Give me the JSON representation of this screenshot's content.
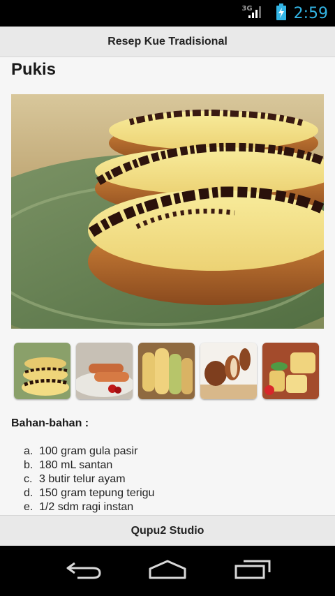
{
  "status_bar": {
    "network_type": "3G",
    "time": "2:59",
    "icons": [
      "signal-icon",
      "battery-charging-icon"
    ],
    "accent_color": "#33b5e5"
  },
  "app_bar": {
    "title": "Resep Kue Tradisional"
  },
  "recipe": {
    "title": "Pukis",
    "main_image": "pukis-cake-photo",
    "thumbnails": [
      {
        "name": "pukis-chocolate-thumbnail"
      },
      {
        "name": "sausage-cake-thumbnail"
      },
      {
        "name": "banana-cake-thumbnail"
      },
      {
        "name": "chocolate-roll-thumbnail"
      },
      {
        "name": "pandan-cake-thumbnail"
      }
    ],
    "ingredients_heading": "Bahan-bahan :",
    "ingredients": [
      {
        "letter": "a.",
        "text": "100 gram gula pasir"
      },
      {
        "letter": "b.",
        "text": "180 mL santan"
      },
      {
        "letter": "c.",
        "text": "3 butir telur ayam"
      },
      {
        "letter": "d.",
        "text": "150 gram tepung terigu"
      },
      {
        "letter": "e.",
        "text": "1/2 sdm ragi instan"
      }
    ]
  },
  "footer": {
    "label": "Qupu2 Studio"
  },
  "nav_bar": {
    "buttons": [
      "back-icon",
      "home-icon",
      "recent-apps-icon"
    ]
  }
}
